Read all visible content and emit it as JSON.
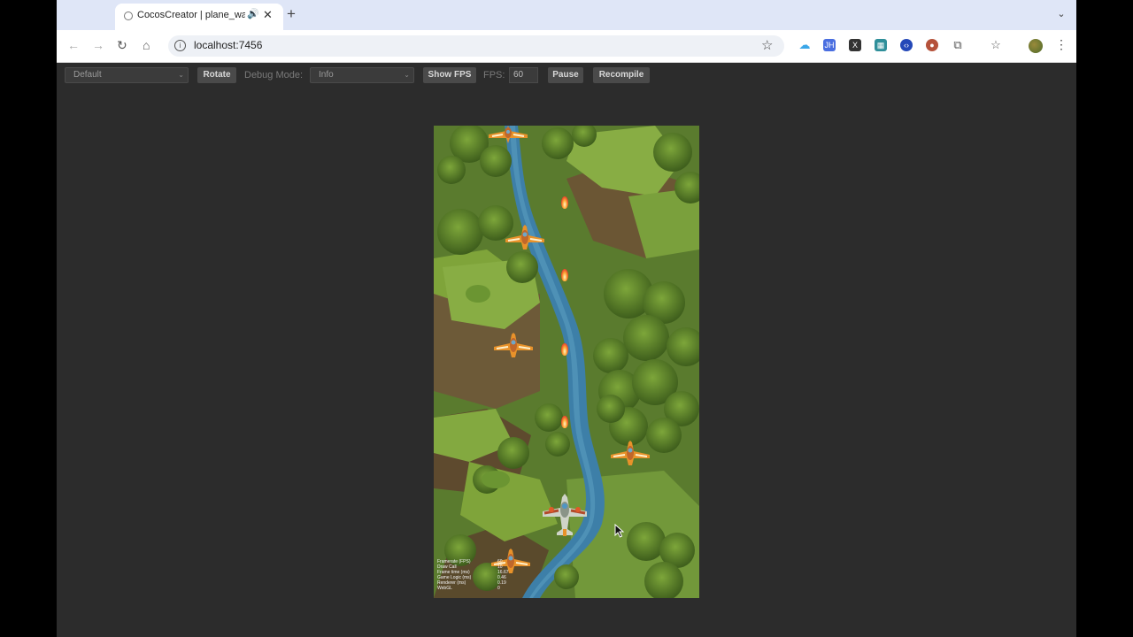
{
  "browser": {
    "tab": {
      "title": "CocosCreator | plane_war",
      "close_glyph": "✕",
      "audio_glyph": "🔊"
    },
    "new_tab_glyph": "+",
    "tab_search_glyph": "⌄",
    "url": "localhost:7456",
    "extensions": [
      {
        "name": "cloud-icon",
        "color": "#3aa6e8"
      },
      {
        "name": "jh-icon",
        "label": "JH",
        "color": "#4a6ee0"
      },
      {
        "name": "x-icon",
        "label": "X",
        "color": "#333333"
      },
      {
        "name": "grid-icon",
        "color": "#2f8f9a"
      },
      {
        "name": "code-icon",
        "color": "#2448b8"
      },
      {
        "name": "cookie-icon",
        "color": "#b5523b"
      },
      {
        "name": "puzzle-icon",
        "color": "#555555"
      }
    ]
  },
  "toolbar": {
    "device_select": "Default",
    "rotate_label": "Rotate",
    "debug_mode_label": "Debug Mode:",
    "debug_mode_value": "Info",
    "show_fps_label": "Show FPS",
    "fps_label": "FPS:",
    "fps_value": "60",
    "pause_label": "Pause",
    "recompile_label": "Recompile"
  },
  "stats": {
    "rows": [
      {
        "label": "Framerate (FPS)",
        "value": "60"
      },
      {
        "label": "Draw Call",
        "value": "10"
      },
      {
        "label": "Frame time (ms)",
        "value": "16.67"
      },
      {
        "label": "Game Logic (ms)",
        "value": "0.46"
      },
      {
        "label": "Renderer (ms)",
        "value": "0.19"
      },
      {
        "label": "WebGL",
        "value": "0"
      }
    ]
  },
  "colors": {
    "enemy_plane": "#e8922a",
    "player_plane": "#cfd3c8",
    "bullet": "#ff5a3a",
    "river": "#3d7fa8"
  }
}
